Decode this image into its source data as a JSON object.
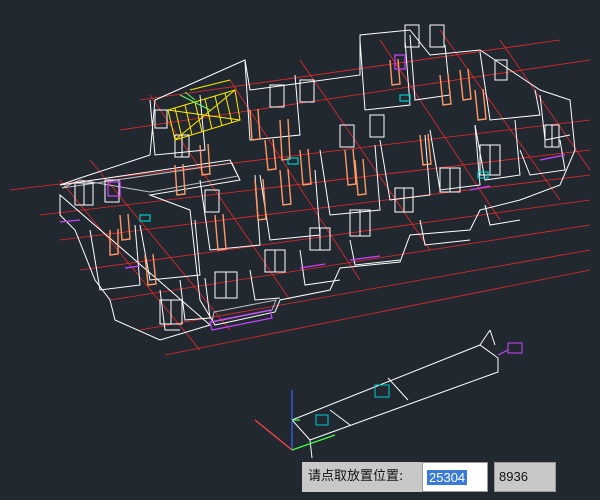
{
  "command": {
    "prompt": "请点取放置位置:",
    "x_value": "25304",
    "y_value": "8936"
  },
  "colors": {
    "background": "#212830",
    "walls": "#ffffff",
    "grid_axes": "#ff2a2a",
    "doors": "#ff9966",
    "stairs": "#ffee00",
    "stairs_alt": "#66ff66",
    "windows": "#ffffff",
    "furniture": "#cc44ff",
    "fixtures": "#00cccc"
  },
  "icons": {
    "ucs": "ucs-axis-icon"
  }
}
